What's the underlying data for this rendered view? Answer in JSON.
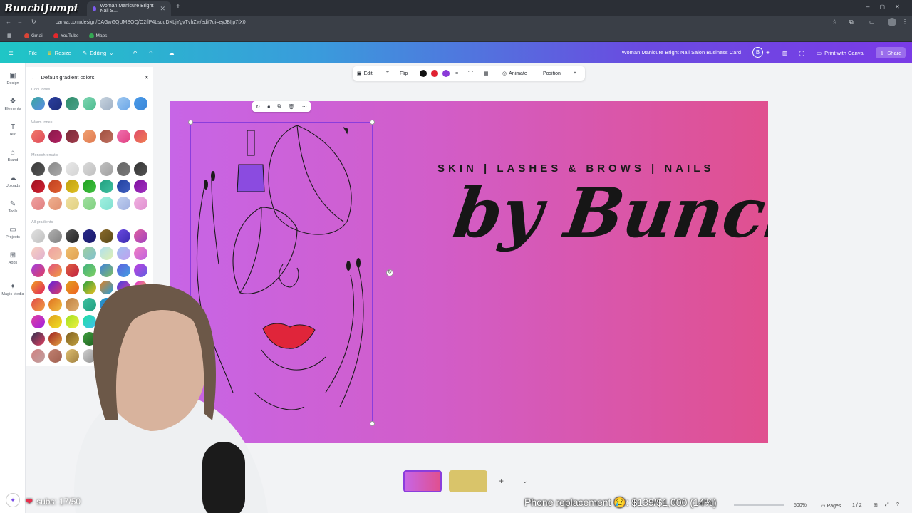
{
  "browser": {
    "tabs": [
      {
        "label": "",
        "active": false
      },
      {
        "label": "Woman Manicure Bright Nail S...",
        "active": true
      }
    ],
    "new_tab_icon": "plus-icon",
    "url": "canva.com/design/DAGwGQUMSOQ/O2flP4LsquDXLjYgvTvhZw/edit?ui=eyJBIjp7fX0",
    "bookmarks": [
      "Gmail",
      "YouTube",
      "Maps"
    ]
  },
  "header": {
    "menu_icon": "hamburger-icon",
    "file_label": "File",
    "resize_label": "Resize",
    "editing_label": "Editing",
    "design_title": "Woman Manicure Bright Nail Salon Business Card",
    "avatar_initial": "B",
    "print_label": "Print with Canva",
    "share_label": "Share"
  },
  "left_rail": [
    {
      "label": "Design",
      "icon": "design-icon"
    },
    {
      "label": "Elements",
      "icon": "elements-icon"
    },
    {
      "label": "Text",
      "icon": "text-icon"
    },
    {
      "label": "Brand",
      "icon": "brand-icon"
    },
    {
      "label": "Uploads",
      "icon": "upload-icon"
    },
    {
      "label": "Tools",
      "icon": "tools-icon"
    },
    {
      "label": "Projects",
      "icon": "folder-icon"
    },
    {
      "label": "Apps",
      "icon": "apps-icon"
    },
    {
      "label": "Magic Media",
      "icon": "magic-icon"
    }
  ],
  "panel": {
    "title": "Default gradient colors",
    "sections": {
      "cool": "Cool tones",
      "warm": "Warm tones",
      "mono": "Monochromatic",
      "all": "All gradients"
    }
  },
  "context_toolbar": {
    "edit_label": "Edit",
    "flip_label": "Flip",
    "animate_label": "Animate",
    "position_label": "Position",
    "colors": [
      "#111111",
      "#e02030",
      "#8a3ad8"
    ]
  },
  "canvas": {
    "tagline": "SKIN | LASHES & BROWS | NAILS",
    "brand": "by Bunchi"
  },
  "bottom": {
    "zoom": "500%",
    "pages_label": "Pages",
    "page_counter": "1 / 2"
  },
  "stream": {
    "logo": "BunchiJumpi",
    "goal_text": "Phone replacement 😢: $139/$1,000 (14%)",
    "subs_text": "subs: 17/50"
  }
}
